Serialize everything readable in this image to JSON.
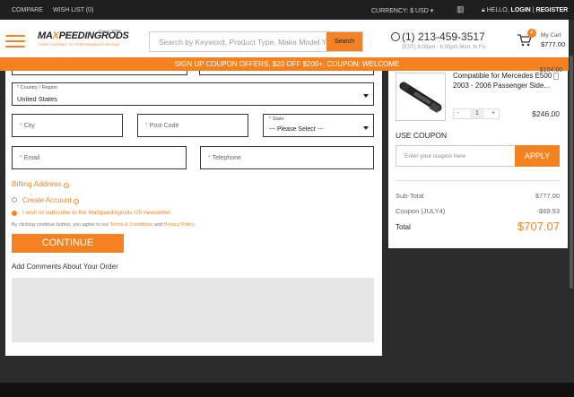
{
  "topbar": {
    "compare": "COMPARE",
    "wishlist": "WISH LIST (0)",
    "currency": "CURRENCY: $ USD",
    "hello": "HELLO,",
    "login": "LOGIN",
    "separator": "|",
    "register": "REGISTER"
  },
  "header": {
    "logo_text_a": "MA",
    "logo_text_x": "X",
    "logo_text_b": "PEEDINGRODS",
    "logo_since": "Since 2006",
    "logo_tagline": "YOUR GATEWAY TO PERFORMANCE DRIVING",
    "search_placeholder": "Search by Keyword, Product Type, Make Model Ye",
    "search_button": "Search",
    "phone": "(1) 213-459-3517",
    "phone_hours": "(EST) 9:00am - 6:00pm Mon. to Fri.",
    "cart_count": "4",
    "cart_label": "My Cart",
    "cart_amount": "$777.00"
  },
  "banner": "SIGN UP COUPON OFFERS, $20 OFF $200+. COUPON: WELCOME",
  "form": {
    "country_label": "* Country / Region",
    "country_value": "United States",
    "city_placeholder": "City",
    "postcode_placeholder": "Post Code",
    "state_label": "* State",
    "state_value": "--- Please Select ---",
    "email_placeholder": "Email",
    "telephone_placeholder": "Telephone",
    "required_mark": "*",
    "billing_address": "Billing Address",
    "create_account": "Create Account",
    "subscribe": "I wish to subscribe to the MaXpeedingrods US newsletter",
    "agree_prefix": "By clicking continue button, you agree to our ",
    "terms": "Terms & Conditions",
    "and": " and ",
    "privacy": "Privacy Policy",
    "continue": "CONTINUE",
    "comments_label": "Add Comments About Your Order"
  },
  "summary": {
    "prev_price_stub": "$104.00",
    "product_name": "Compatible for Mercedes E500 2003 - 2006 Passenger Side...",
    "qty_minus": "-",
    "qty_value": "1",
    "qty_plus": "+",
    "product_price": "$246.00",
    "use_coupon": "USE COUPON",
    "coupon_placeholder": "Enter your coupon here",
    "apply": "APPLY",
    "subtotal_label": "Sub-Total",
    "subtotal_value": "$777.00",
    "coupon_label": "Coupon (JULY4)",
    "coupon_value": "-$69.93",
    "total_label": "Total",
    "total_value": "$707.07"
  },
  "colors": {
    "accent": "#f58220",
    "topbar": "#1f1f1f"
  }
}
